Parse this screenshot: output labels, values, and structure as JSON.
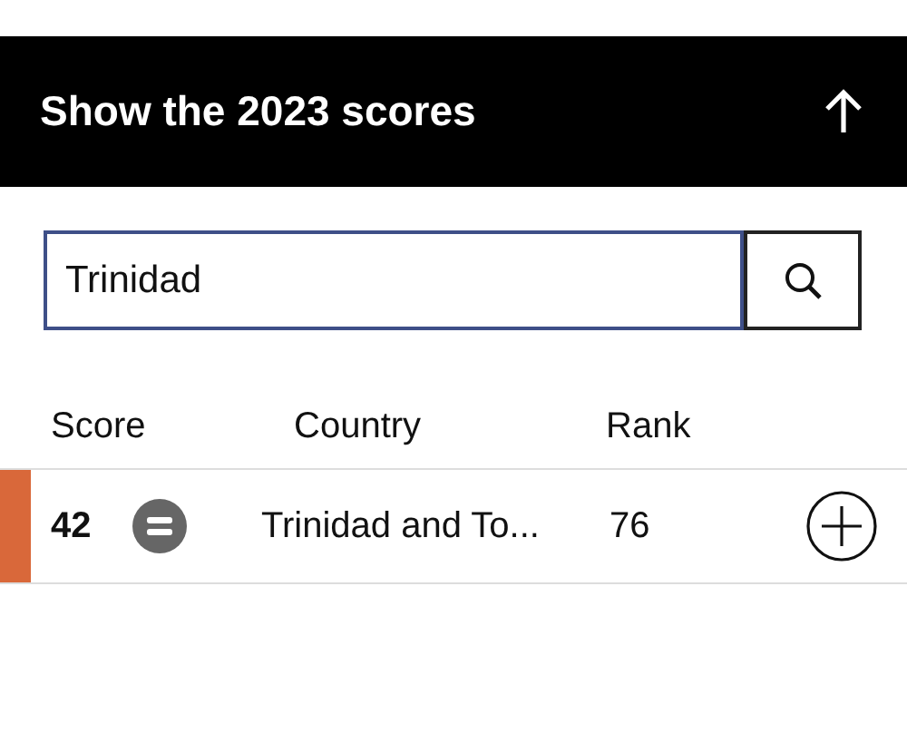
{
  "header": {
    "title": "Show the 2023 scores"
  },
  "search": {
    "value": "Trinidad"
  },
  "table": {
    "columns": [
      "Score",
      "Country",
      "Rank"
    ],
    "rows": [
      {
        "score": "42",
        "kind": "same",
        "country": "Trinidad and To...",
        "rank": "76",
        "color": "#d9683a"
      }
    ]
  }
}
